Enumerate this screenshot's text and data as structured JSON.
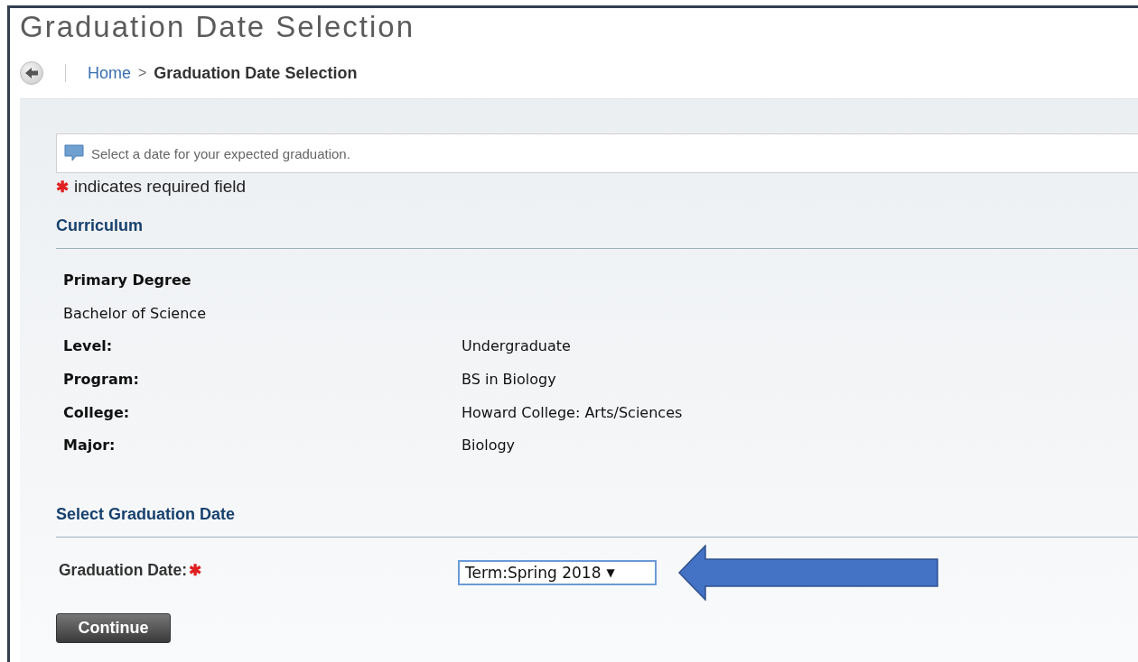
{
  "page_title": "Graduation Date Selection",
  "breadcrumb": {
    "home": "Home",
    "separator": ">",
    "current": "Graduation Date Selection"
  },
  "info_message": "Select a date for your expected graduation.",
  "required_note": {
    "mark": "✱",
    "text": "indicates required field"
  },
  "curriculum": {
    "heading": "Curriculum",
    "degree_heading": "Primary Degree",
    "degree": "Bachelor of Science",
    "rows": [
      {
        "label": "Level:",
        "value": "Undergraduate"
      },
      {
        "label": "Program:",
        "value": "BS in Biology"
      },
      {
        "label": "College:",
        "value": "Howard College: Arts/Sciences"
      },
      {
        "label": "Major:",
        "value": "Biology"
      }
    ]
  },
  "graduation": {
    "heading": "Select Graduation Date",
    "label": "Graduation Date:",
    "required_mark": "✱",
    "select_value": "Term:Spring 2018",
    "caret": "▼"
  },
  "continue_button": "Continue"
}
